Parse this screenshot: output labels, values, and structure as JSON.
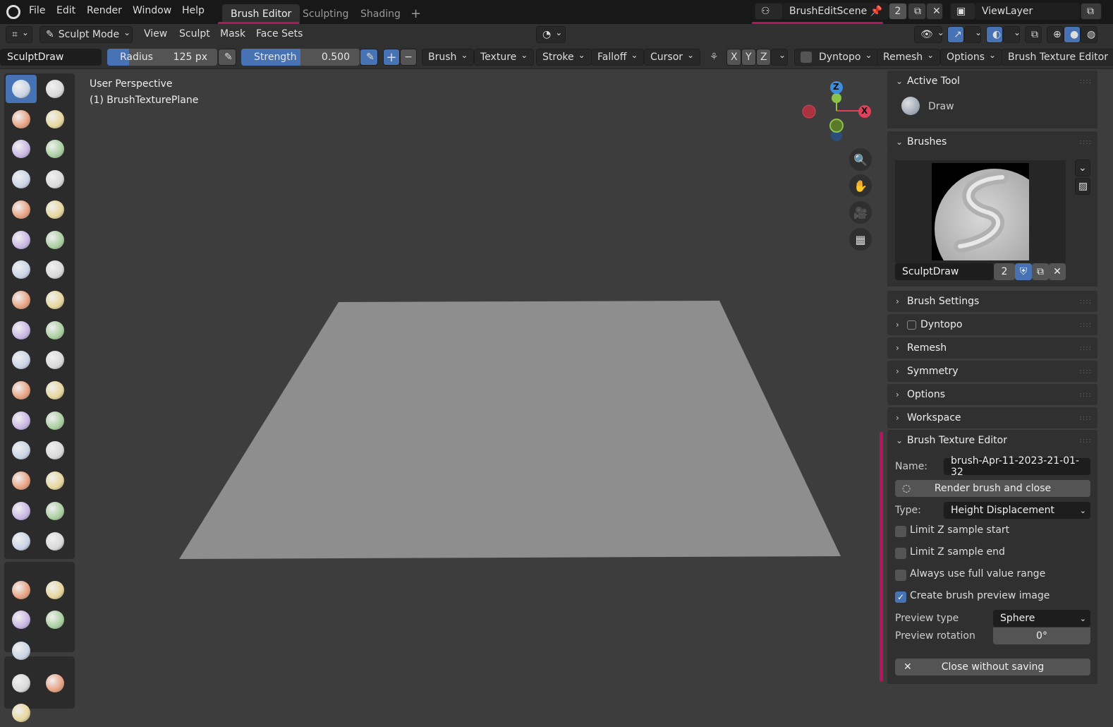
{
  "topbar": {
    "menus": [
      "File",
      "Edit",
      "Render",
      "Window",
      "Help"
    ],
    "workspaces": [
      "Brush Editor",
      "Sculpting",
      "Shading"
    ],
    "active_workspace": "Brush Editor",
    "add_tab": "+",
    "scene": "BrushEditScene",
    "scene_users": "2",
    "view_layer": "ViewLayer"
  },
  "header": {
    "mode": "Sculpt Mode",
    "menus": [
      "View",
      "Sculpt",
      "Mask",
      "Face Sets"
    ]
  },
  "tool_settings": {
    "brush_name": "SculptDraw",
    "radius_label": "Radius",
    "radius_value": "125 px",
    "strength_label": "Strength",
    "strength_value": "0.500",
    "radius_fraction": 0.2,
    "strength_fraction": 0.5,
    "plus": "+",
    "minus": "−",
    "dropdowns": [
      "Brush",
      "Texture",
      "Stroke",
      "Falloff",
      "Cursor"
    ],
    "axes": [
      "X",
      "Y",
      "Z"
    ],
    "dyntopo": "Dyntopo",
    "remesh": "Remesh",
    "options": "Options",
    "brush_texture_editor": "Brush Texture Editor"
  },
  "viewport": {
    "line1": "User Perspective",
    "line2": "(1) BrushTexturePlane",
    "gizmo": {
      "z": "Z",
      "x": "X"
    }
  },
  "tools": [
    "draw",
    "draw-sharp",
    "clay",
    "clay-strips",
    "clay-thumb",
    "layer",
    "inflate",
    "blob",
    "crease",
    "smooth",
    "flatten",
    "fill",
    "scrape",
    "multiplane-scrape",
    "pinch",
    "grab",
    "elastic-deform",
    "snake-hook",
    "thumb",
    "pose",
    "nudge",
    "rotate",
    "slide-relax",
    "boundary",
    "cloth",
    "simplify",
    "mask",
    "draw-face-sets",
    "multires-eraser",
    "multires-smear",
    "paint",
    "smear",
    "box-mask",
    "box-hide",
    "box-face-set",
    "box-trim",
    "line-project",
    "mesh-filter",
    "cloth-filter",
    "color-filter"
  ],
  "panel": {
    "active_tool": {
      "title": "Active Tool",
      "tool": "Draw"
    },
    "brushes": {
      "title": "Brushes",
      "name": "SculptDraw",
      "users": "2"
    },
    "sections": [
      "Brush Settings",
      "Dyntopo",
      "Remesh",
      "Symmetry",
      "Options",
      "Workspace"
    ],
    "bte": {
      "title": "Brush Texture Editor",
      "name_label": "Name:",
      "name_value": "brush-Apr-11-2023-21-01-32",
      "render_button": "Render brush and close",
      "type_label": "Type:",
      "type_value": "Height Displacement",
      "checks": [
        {
          "label": "Limit Z sample start",
          "checked": false
        },
        {
          "label": "Limit Z sample end",
          "checked": false
        },
        {
          "label": "Always use full value range",
          "checked": false
        },
        {
          "label": "Create brush preview image",
          "checked": true
        }
      ],
      "preview_type_label": "Preview type",
      "preview_type_value": "Sphere",
      "preview_rotation_label": "Preview rotation",
      "preview_rotation_value": "0°",
      "close_button": "Close without saving"
    }
  },
  "colors": {
    "accent": "#4772b3",
    "highlight": "#b8135f",
    "x_axis": "#e0405a",
    "y_axis": "#8bc34a",
    "z_axis": "#3b8ee0"
  }
}
